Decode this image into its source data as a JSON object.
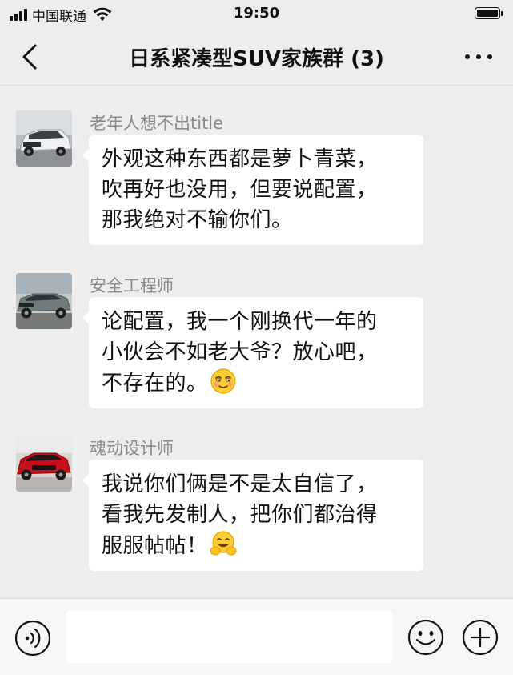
{
  "status_bar": {
    "carrier": "中国联通",
    "time": "19:50"
  },
  "nav": {
    "title": "日系紧凑型SUV家族群 (3)"
  },
  "messages": [
    {
      "sender": "老年人想不出title",
      "avatar_icon": "white-suv-avatar",
      "lines": [
        "外观这种东西都是萝卜青菜，",
        "吹再好也没用，但要说配置，",
        "那我绝对不输你们。"
      ]
    },
    {
      "sender": "安全工程师",
      "avatar_icon": "grey-suv-avatar",
      "lines": [
        "论配置，我一个刚换代一年的",
        "小伙会不如老大爷？放心吧，",
        "不存在的。"
      ],
      "emoji": "smug-face-emoji"
    },
    {
      "sender": "魂动设计师",
      "avatar_icon": "red-suv-avatar",
      "lines": [
        "我说你们俩是不是太自信了，",
        "看我先发制人，把你们都治得",
        "服服帖帖！"
      ],
      "emoji": "hugging-face-emoji"
    }
  ],
  "input": {
    "value": "",
    "placeholder": ""
  },
  "colors": {
    "background": "#ededed",
    "bubble": "#ffffff",
    "sender_name": "#8a8a8a"
  }
}
